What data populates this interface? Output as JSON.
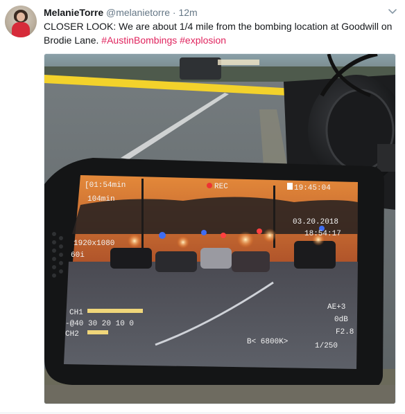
{
  "tweet": {
    "display_name": "MelanieTorre",
    "handle": "@melanietorre",
    "separator": "·",
    "time": "12m",
    "text_main": "CLOSER LOOK: We are about 1/4 mile from the bombing location at Goodwill on Brodie Lane.",
    "hashtags": [
      "#AustinBombings",
      "#explosion"
    ]
  },
  "camera_screen": {
    "top_left_1": "[01:54min",
    "top_left_2": "104min",
    "rec": "REC",
    "timecode": "19:45:04",
    "date": "03.20.2018",
    "clock": "18:54:17",
    "format": "1920x1080",
    "fps": "60i",
    "audio_ch1": "CH1",
    "audio_ch2": "CH2",
    "audio_scale": "-@40 30 20 10 0",
    "ae": "AE+3",
    "gain": "0dB",
    "iris": "F2.8",
    "white_balance": "B< 6800K>",
    "shutter": "1/250"
  },
  "colors": {
    "hashtag": "#e0245e",
    "muted": "#657786",
    "tape": "#f3d22b"
  },
  "icons": {
    "caret": "chevron-down-icon"
  }
}
